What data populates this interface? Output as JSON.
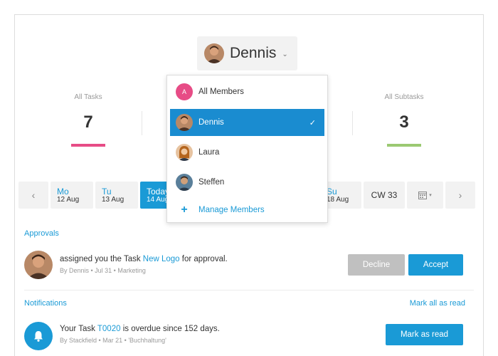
{
  "member_selector": {
    "name": "Dennis"
  },
  "stats": {
    "all_tasks": {
      "label": "All Tasks",
      "value": "7",
      "color": "#e74c86"
    },
    "all_subtasks": {
      "label": "All Subtasks",
      "value": "3",
      "color": "#9bc972"
    }
  },
  "dropdown": {
    "items": [
      {
        "label": "All Members",
        "initial": "A",
        "avatar_color": "#e74c86"
      },
      {
        "label": "Dennis",
        "selected": true
      },
      {
        "label": "Laura"
      },
      {
        "label": "Steffen"
      }
    ],
    "manage_label": "Manage Members"
  },
  "dates": [
    {
      "day": "Mo",
      "date": "12 Aug"
    },
    {
      "day": "Tu",
      "date": "13 Aug"
    },
    {
      "day": "Today",
      "date": "14 Aug"
    },
    {
      "day": "Su",
      "date": "18 Aug"
    }
  ],
  "calendar_week": "CW 33",
  "approvals": {
    "title": "Approvals",
    "message_before": "assigned you the Task",
    "task_link": "New Logo",
    "message_after": "for approval.",
    "meta": "By Dennis • Jul 31 • Marketing",
    "decline_label": "Decline",
    "accept_label": "Accept"
  },
  "notifications": {
    "title": "Notifications",
    "mark_all_label": "Mark all as read",
    "message_before": "Your Task",
    "task_link": "T0020",
    "message_after": "is overdue since 152 days.",
    "meta": "By Stackfield • Mar 21 • 'Buchhaltung'",
    "mark_read_label": "Mark as read"
  },
  "colors": {
    "accent": "#1a9ad6",
    "pink": "#e74c86",
    "green": "#9bc972"
  }
}
